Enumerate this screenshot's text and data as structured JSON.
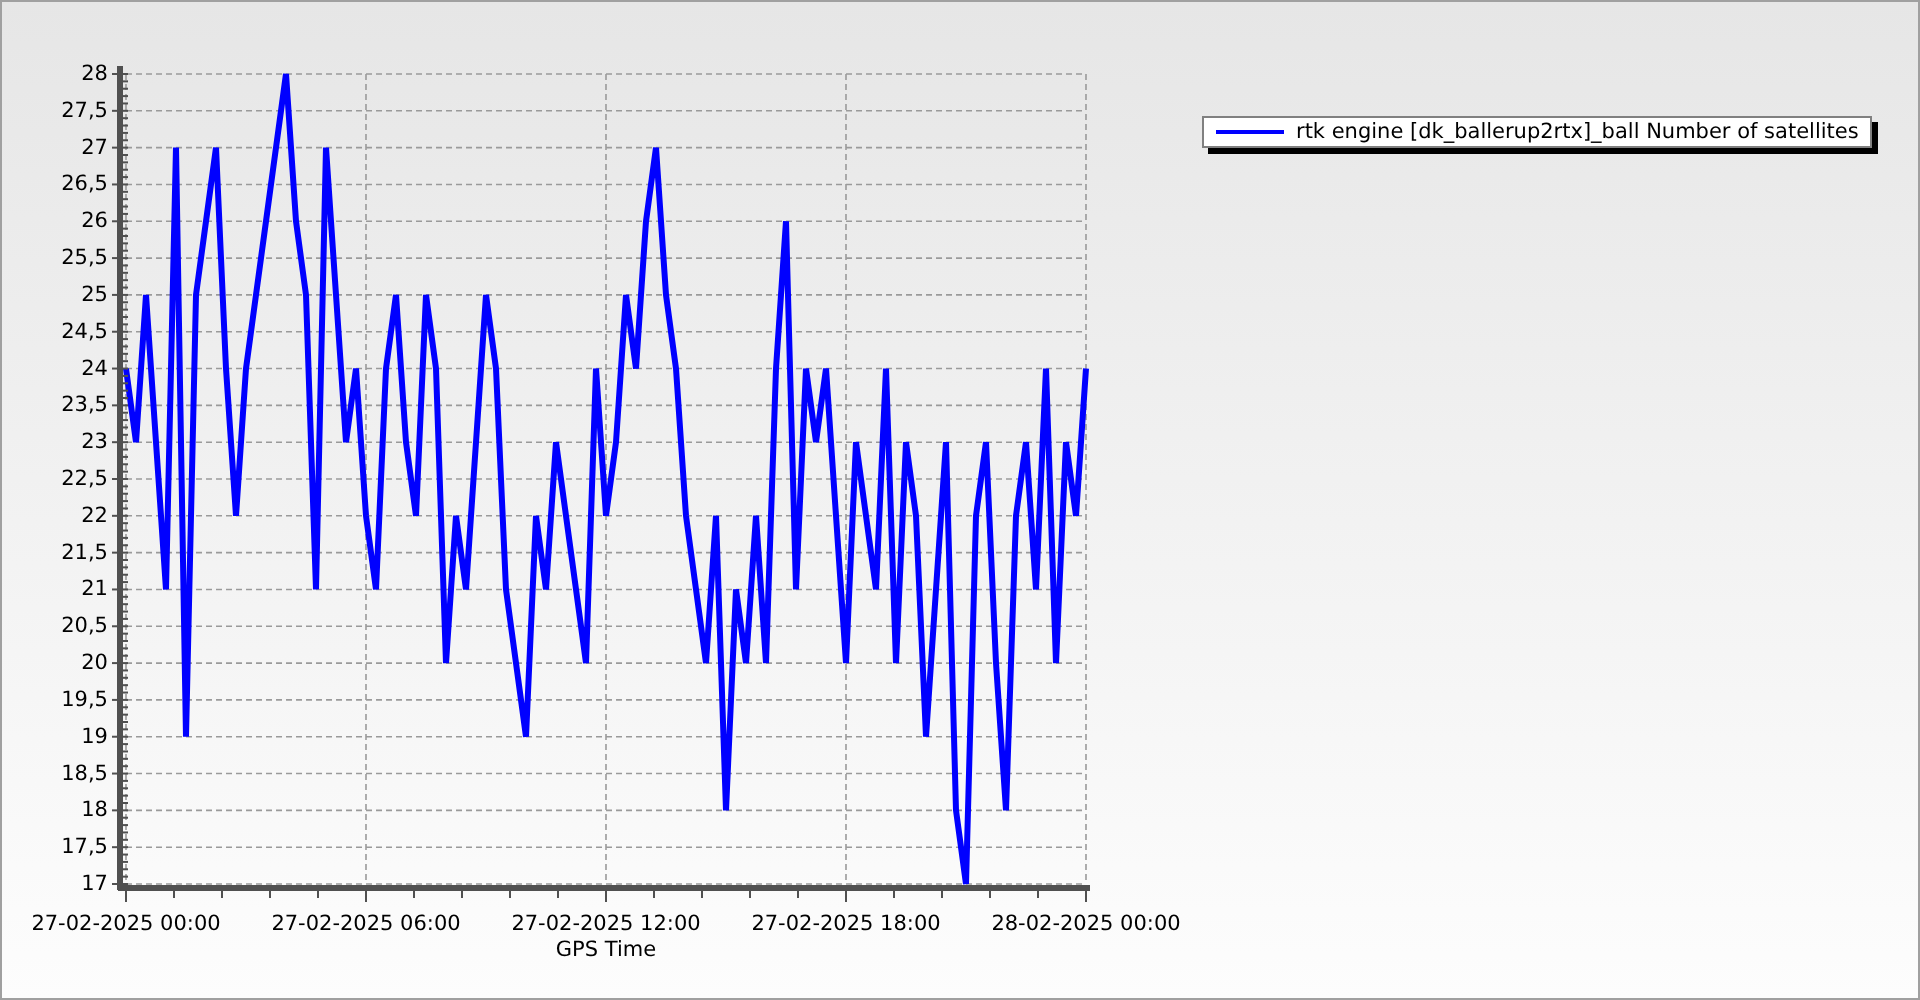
{
  "chart_data": {
    "type": "line",
    "grid": true,
    "xlabel": "GPS Time",
    "ylim": [
      17,
      28
    ],
    "yticks": [
      17,
      {
        "value": 17.5,
        "label": "17,5"
      },
      18,
      {
        "value": 18.5,
        "label": "18,5"
      },
      19,
      {
        "value": 19.5,
        "label": "19,5"
      },
      20,
      {
        "value": 20.5,
        "label": "20,5"
      },
      21,
      {
        "value": 21.5,
        "label": "21,5"
      },
      22,
      {
        "value": 22.5,
        "label": "22,5"
      },
      23,
      {
        "value": 23.5,
        "label": "23,5"
      },
      24,
      {
        "value": 24.5,
        "label": "24,5"
      },
      25,
      {
        "value": 25.5,
        "label": "25,5"
      },
      26,
      {
        "value": 26.5,
        "label": "26,5"
      },
      27,
      {
        "value": 27.5,
        "label": "27,5"
      },
      28
    ],
    "categories": [
      "27-02-2025 00:00",
      null,
      null,
      null,
      null,
      null,
      null,
      null,
      null,
      null,
      null,
      null,
      null,
      null,
      null,
      null,
      null,
      null,
      null,
      null,
      null,
      null,
      null,
      null,
      "27-02-2025 06:00",
      null,
      null,
      null,
      null,
      null,
      null,
      null,
      null,
      null,
      null,
      null,
      null,
      null,
      null,
      null,
      null,
      null,
      null,
      null,
      null,
      null,
      null,
      null,
      "27-02-2025 12:00",
      null,
      null,
      null,
      null,
      null,
      null,
      null,
      null,
      null,
      null,
      null,
      null,
      null,
      null,
      null,
      null,
      null,
      null,
      null,
      null,
      null,
      null,
      null,
      "27-02-2025 18:00",
      null,
      null,
      null,
      null,
      null,
      null,
      null,
      null,
      null,
      null,
      null,
      null,
      null,
      null,
      null,
      null,
      null,
      null,
      null,
      null,
      null,
      null,
      null,
      "28-02-2025 00:00"
    ],
    "series": [
      {
        "name": "rtk engine [dk_ballerup2rtx]_ball Number of satellites",
        "color": "#0000ff",
        "values": [
          24,
          23,
          25,
          23,
          21,
          27,
          19,
          25,
          26,
          27,
          24,
          22,
          24,
          25,
          26,
          27,
          28,
          26,
          25,
          21,
          27,
          25,
          23,
          24,
          22,
          21,
          24,
          25,
          23,
          22,
          25,
          24,
          20,
          22,
          21,
          23,
          25,
          24,
          21,
          20,
          19,
          22,
          21,
          23,
          22,
          21,
          20,
          24,
          22,
          23,
          25,
          24,
          26,
          27,
          25,
          24,
          22,
          21,
          20,
          22,
          18,
          21,
          20,
          22,
          20,
          24,
          26,
          21,
          24,
          23,
          24,
          22,
          20,
          23,
          22,
          21,
          24,
          20,
          23,
          22,
          19,
          21,
          23,
          18,
          17,
          22,
          23,
          20,
          18,
          22,
          23,
          21,
          24,
          20,
          23,
          22,
          24
        ]
      }
    ]
  }
}
